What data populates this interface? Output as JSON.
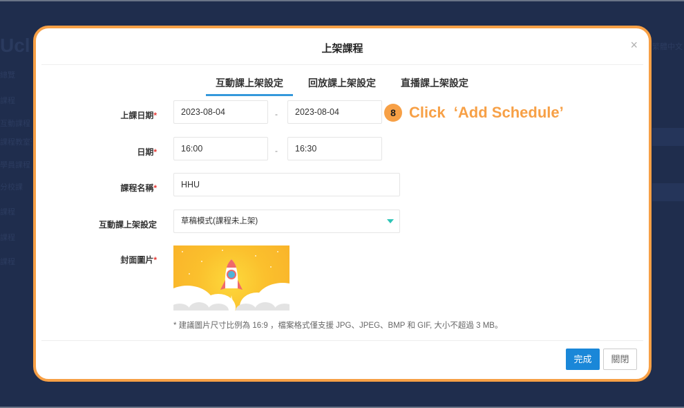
{
  "background": {
    "logo_text": "Ucl",
    "sidebar_items": [
      "總覽",
      "課程",
      "互動課程",
      "課程教室預約",
      "學員課程",
      "分校課",
      "課程",
      "課程",
      "課程"
    ],
    "language_label": "繁體中文"
  },
  "modal": {
    "title": "上架課程",
    "close_icon": "×",
    "tabs": [
      {
        "label": "互動課上架設定",
        "active": true
      },
      {
        "label": "回放課上架設定",
        "active": false
      },
      {
        "label": "直播課上架設定",
        "active": false
      }
    ],
    "form": {
      "class_date": {
        "label": "上課日期",
        "required": "*",
        "start": "2023-08-04",
        "end": "2023-08-04",
        "separator": "-"
      },
      "time": {
        "label": "日期",
        "required": "*",
        "start": "16:00",
        "end": "16:30",
        "separator": "-"
      },
      "course_name": {
        "label": "課程名稱",
        "required": "*",
        "value": "HHU"
      },
      "publish_setting": {
        "label": "互動課上架設定",
        "selected": "草稿模式(課程未上架)"
      },
      "cover_image": {
        "label": "封面圖片",
        "required": "*",
        "image_desc": "rocket launch illustration"
      },
      "hint": "* 建議圖片尺寸比例為 16:9 ，檔案格式僅支援 JPG、JPEG、BMP 和 GIF, 大小不超過 3 MB。"
    },
    "footer": {
      "done_label": "完成",
      "close_label": "關閉"
    }
  },
  "annotation": {
    "step": "8",
    "text": "Click  ‘Add Schedule’",
    "color": "#f7a046"
  },
  "colors": {
    "accent_blue": "#1a87d8",
    "tab_underline": "#3498db",
    "highlight_border": "#f7a046",
    "caret": "#2ec4b6",
    "required": "#e53935"
  }
}
